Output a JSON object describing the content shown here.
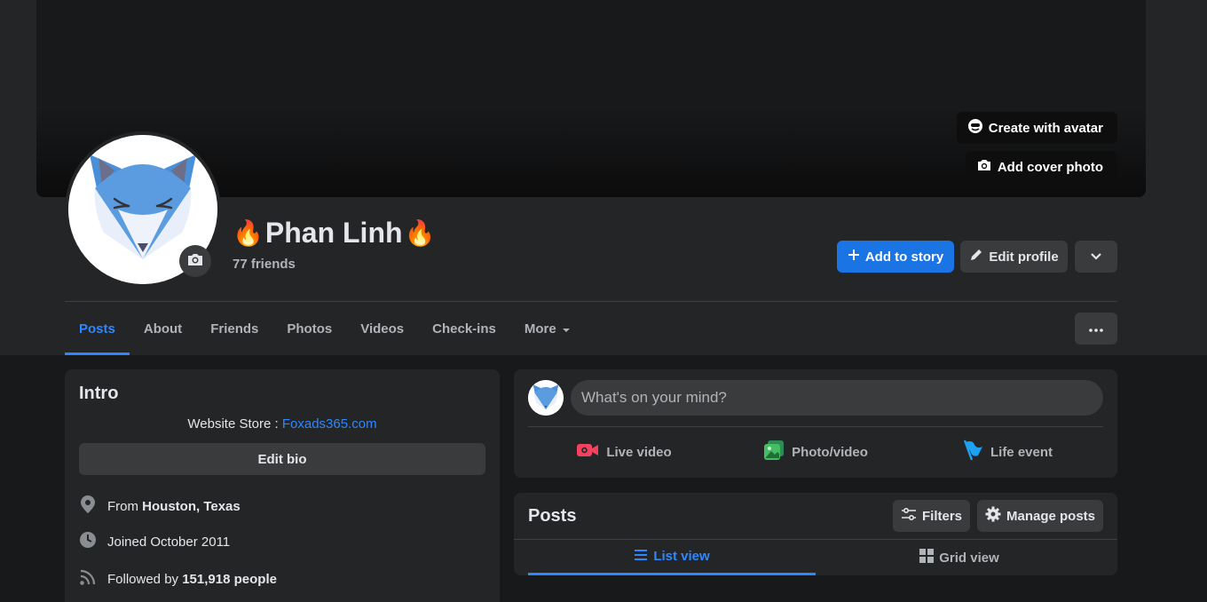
{
  "cover": {
    "create_avatar_label": "Create with avatar",
    "add_cover_label": "Add cover photo"
  },
  "profile": {
    "name": "Phan Linh",
    "name_prefix_emoji": "🔥",
    "name_suffix_emoji": "🔥",
    "friends_count": "77 friends"
  },
  "actions": {
    "add_story_label": "Add to story",
    "edit_profile_label": "Edit profile"
  },
  "tabs": [
    {
      "label": "Posts"
    },
    {
      "label": "About"
    },
    {
      "label": "Friends"
    },
    {
      "label": "Photos"
    },
    {
      "label": "Videos"
    },
    {
      "label": "Check-ins"
    },
    {
      "label": "More"
    }
  ],
  "intro": {
    "title": "Intro",
    "website_prefix": "Website Store : ",
    "website_link": "Foxads365.com",
    "edit_bio_label": "Edit bio",
    "from_prefix": "From ",
    "from_value": "Houston, Texas",
    "joined": "Joined October 2011",
    "followed_prefix": "Followed by ",
    "followed_value": "151,918 people"
  },
  "composer": {
    "placeholder": "What's on your mind?",
    "live_video": "Live video",
    "photo_video": "Photo/video",
    "life_event": "Life event"
  },
  "posts": {
    "title": "Posts",
    "filters_label": "Filters",
    "manage_label": "Manage posts",
    "list_view_label": "List view",
    "grid_view_label": "Grid view"
  },
  "colors": {
    "accent": "#2d88ff",
    "primary_button": "#1b74e4",
    "card": "#242526",
    "background": "#18191a"
  }
}
